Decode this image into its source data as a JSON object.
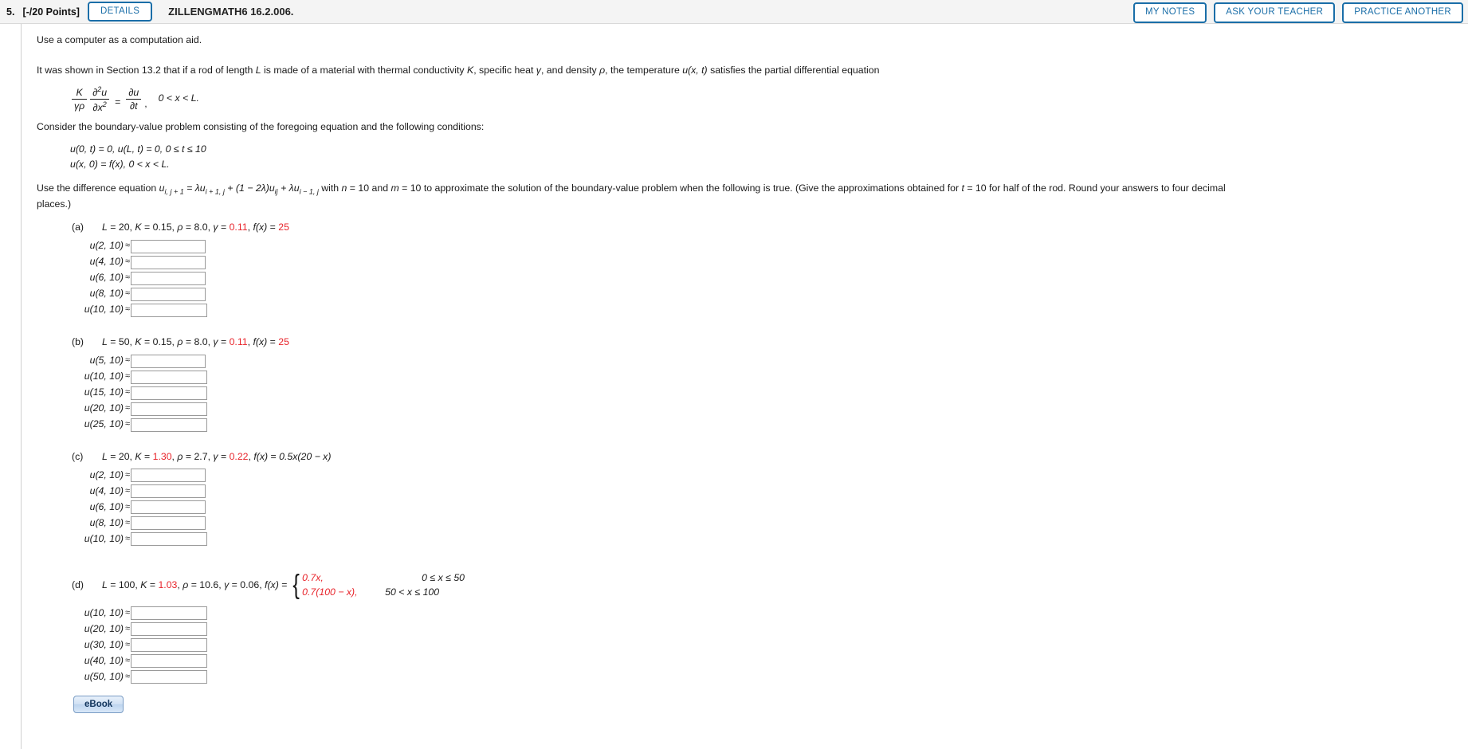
{
  "header": {
    "question_number": "5.",
    "points": "[-/20 Points]",
    "details_label": "DETAILS",
    "assignment_code": "ZILLENGMATH6 16.2.006.",
    "my_notes_label": "MY NOTES",
    "ask_teacher_label": "ASK YOUR TEACHER",
    "practice_another_label": "PRACTICE ANOTHER",
    "accent_color": "#1a6ea8",
    "bar_background": "#f4f4f4"
  },
  "body": {
    "instruction": "Use a computer as a computation aid.",
    "intro_pre": "It was shown in Section 13.2 that if a rod of length ",
    "intro_L": "L",
    "intro_mid1": " is made of a material with thermal conductivity ",
    "intro_K": "K",
    "intro_mid2": ", specific heat ",
    "intro_gamma": "γ",
    "intro_mid3": ", and density ",
    "intro_rho": "ρ",
    "intro_mid4": ", the temperature ",
    "intro_u": "u(x, t)",
    "intro_end": " satisfies the partial differential equation",
    "equation": {
      "frac1_num": "K",
      "frac1_den": "γρ",
      "frac2_num": "∂",
      "frac2_num_sup": "2",
      "frac2_num_var": "u",
      "frac2_den": "∂x",
      "frac2_den_sup": "2",
      "equals": "=",
      "frac3_num": "∂u",
      "frac3_den": "∂t",
      "comma": ",",
      "domain": "0 < x < L."
    },
    "consider": "Consider the boundary-value problem consisting of the foregoing equation and the following conditions:",
    "bc1": "u(0, t) = 0,   u(L, t) = 0,   0 ≤ t ≤ 10",
    "bc2": "u(x, 0) = f(x),   0 < x < L.",
    "diffeq_pre": "Use the difference equation ",
    "diffeq_formula": "u",
    "diffeq_sub1": "i, j + 1",
    "diffeq_eq": " = λu",
    "diffeq_sub2": "i + 1, j",
    "diffeq_mid": " + (1 − 2λ)u",
    "diffeq_sub3": "ij",
    "diffeq_mid2": " + λu",
    "diffeq_sub4": "i − 1, j",
    "diffeq_with": " with ",
    "diffeq_n": "n",
    "diffeq_n_val": " = 10",
    "diffeq_and": "  and  ",
    "diffeq_m": "m",
    "diffeq_m_val": " = 10",
    "diffeq_post": "  to approximate the solution of the boundary-value problem when the following is true. (Give the approximations obtained for  ",
    "diffeq_t": "t",
    "diffeq_t_val": " = 10",
    "diffeq_tail": "  for half of the rod. Round your answers to four decimal places.)"
  },
  "red_color": "#e8242b",
  "parts": [
    {
      "label": "(a)",
      "params": [
        {
          "sym": "L",
          "eq": " = ",
          "val": "20",
          "red": false,
          "sep": ", "
        },
        {
          "sym": "K",
          "eq": " = ",
          "val": "0.15",
          "red": false,
          "sep": ", "
        },
        {
          "sym": "ρ",
          "eq": " = ",
          "val": "8.0",
          "red": false,
          "sep": ", "
        },
        {
          "sym": "γ",
          "eq": " = ",
          "val": "0.11",
          "red": true,
          "sep": ", "
        },
        {
          "sym": "f(x)",
          "eq": " = ",
          "val": "25",
          "red": true,
          "sep": ""
        }
      ],
      "piecewise": null,
      "answers": [
        {
          "label": "u(2, 10)",
          "value": ""
        },
        {
          "label": "u(4, 10)",
          "value": ""
        },
        {
          "label": "u(6, 10)",
          "value": ""
        },
        {
          "label": "u(8, 10)",
          "value": ""
        },
        {
          "label": "u(10, 10)",
          "value": ""
        }
      ]
    },
    {
      "label": "(b)",
      "params": [
        {
          "sym": "L",
          "eq": " = ",
          "val": "50",
          "red": false,
          "sep": ", "
        },
        {
          "sym": "K",
          "eq": " = ",
          "val": "0.15",
          "red": false,
          "sep": ", "
        },
        {
          "sym": "ρ",
          "eq": " = ",
          "val": "8.0",
          "red": false,
          "sep": ", "
        },
        {
          "sym": "γ",
          "eq": " = ",
          "val": "0.11",
          "red": true,
          "sep": ", "
        },
        {
          "sym": "f(x)",
          "eq": " = ",
          "val": "25",
          "red": true,
          "sep": ""
        }
      ],
      "piecewise": null,
      "answers": [
        {
          "label": "u(5, 10)",
          "value": ""
        },
        {
          "label": "u(10, 10)",
          "value": ""
        },
        {
          "label": "u(15, 10)",
          "value": ""
        },
        {
          "label": "u(20, 10)",
          "value": ""
        },
        {
          "label": "u(25, 10)",
          "value": ""
        }
      ]
    },
    {
      "label": "(c)",
      "params": [
        {
          "sym": "L",
          "eq": " = ",
          "val": "20",
          "red": false,
          "sep": ", "
        },
        {
          "sym": "K",
          "eq": " = ",
          "val": "1.30",
          "red": true,
          "sep": ", "
        },
        {
          "sym": "ρ",
          "eq": " = ",
          "val": "2.7",
          "red": false,
          "sep": ", "
        },
        {
          "sym": "γ",
          "eq": " = ",
          "val": "0.22",
          "red": true,
          "sep": ", "
        },
        {
          "sym": "f(x)",
          "eq": " = ",
          "val": "0.5x(20 − x)",
          "red": false,
          "sep": ""
        }
      ],
      "piecewise": null,
      "answers": [
        {
          "label": "u(2, 10)",
          "value": ""
        },
        {
          "label": "u(4, 10)",
          "value": ""
        },
        {
          "label": "u(6, 10)",
          "value": ""
        },
        {
          "label": "u(8, 10)",
          "value": ""
        },
        {
          "label": "u(10, 10)",
          "value": ""
        }
      ]
    },
    {
      "label": "(d)",
      "params": [
        {
          "sym": "L",
          "eq": " = ",
          "val": "100",
          "red": false,
          "sep": ", "
        },
        {
          "sym": "K",
          "eq": " = ",
          "val": "1.03",
          "red": true,
          "sep": ", "
        },
        {
          "sym": "ρ",
          "eq": " = ",
          "val": "10.6",
          "red": false,
          "sep": ", "
        },
        {
          "sym": "γ",
          "eq": " = ",
          "val": "0.06",
          "red": false,
          "sep": ", "
        },
        {
          "sym": "f(x)",
          "eq": " = ",
          "val": "",
          "red": false,
          "sep": ""
        }
      ],
      "piecewise": {
        "row1_expr": "0.7x,",
        "row1_domain": "0 ≤ x ≤ 50",
        "row2_expr": "0.7(100 − x),",
        "row2_domain": "50 < x ≤ 100",
        "expr_color": "#e8242b"
      },
      "answers": [
        {
          "label": "u(10, 10)",
          "value": ""
        },
        {
          "label": "u(20, 10)",
          "value": ""
        },
        {
          "label": "u(30, 10)",
          "value": ""
        },
        {
          "label": "u(40, 10)",
          "value": ""
        },
        {
          "label": "u(50, 10)",
          "value": ""
        }
      ]
    }
  ],
  "footer": {
    "ebook_label": "eBook"
  }
}
